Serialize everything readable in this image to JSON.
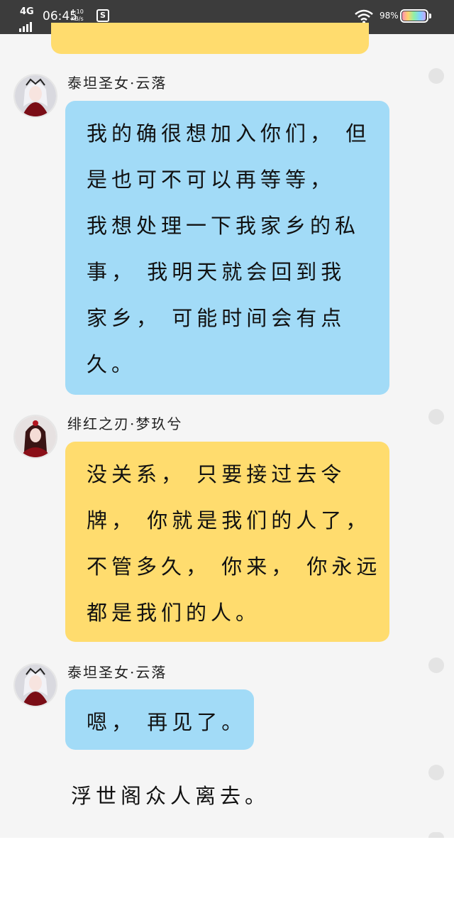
{
  "status_bar": {
    "network": "4G",
    "time": "06:45",
    "speed_value": "4.10",
    "speed_unit": "KB/s",
    "app_icon_letter": "S",
    "battery_text": "98%",
    "battery_level": 0.98
  },
  "messages": [
    {
      "sender": "泰坦圣女·云落",
      "color": "blue",
      "lines": [
        "我的确很想加入你们， 但",
        "是也可不可以再等等，",
        "我想处理一下我家乡的私",
        "事， 我明天就会回到我",
        "家乡， 可能时间会有点",
        "久。"
      ]
    },
    {
      "sender": "绯红之刃·梦玖兮",
      "color": "yellow",
      "lines": [
        "没关系， 只要接过去令",
        "牌， 你就是我们的人了，",
        "不管多久， 你来， 你永远",
        "都是我们的人。"
      ]
    },
    {
      "sender": "泰坦圣女·云落",
      "color": "blue",
      "lines": [
        "嗯， 再见了。"
      ]
    }
  ],
  "narration": "浮世阁众人离去。",
  "colors": {
    "blue_bubble": "#a2dbf7",
    "yellow_bubble": "#ffdc6e",
    "background": "#f5f5f5",
    "status_bar": "#3c3c3c"
  }
}
